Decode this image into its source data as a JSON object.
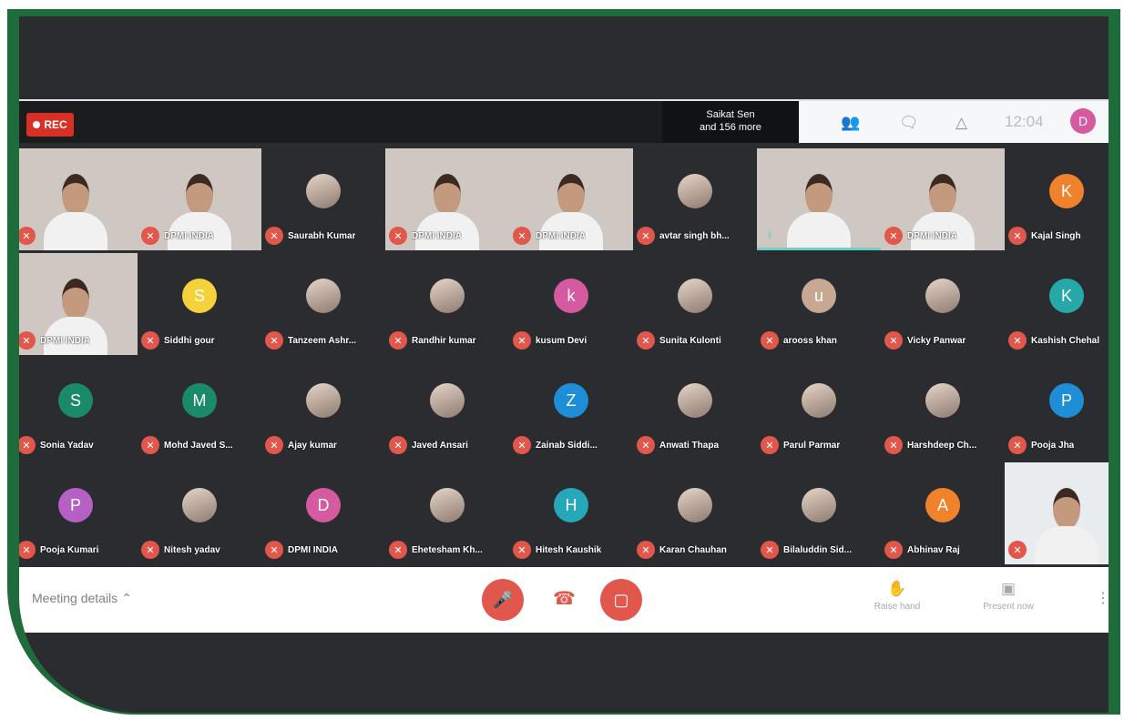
{
  "recording_label": "REC",
  "presenter": {
    "line1": "Saikat Sen",
    "line2": "and 156 more"
  },
  "topbar": {
    "participants_icon": "people-icon",
    "chat_icon": "chat-icon",
    "activities_icon": "shapes-icon",
    "time": "12:04",
    "self_initial": "D"
  },
  "colors": {
    "accent_red": "#e2574c",
    "frame_green": "#1e6b3b",
    "grid_bg": "#2a2c30"
  },
  "tiles": [
    {
      "name": "",
      "kind": "video"
    },
    {
      "name": "DPMI INDIA",
      "kind": "video"
    },
    {
      "name": "Saurabh Kumar",
      "kind": "avatar",
      "color": "photo"
    },
    {
      "name": "DPMI INDIA",
      "kind": "video"
    },
    {
      "name": "DPMI INDIA",
      "kind": "video"
    },
    {
      "name": "avtar singh bh...",
      "kind": "avatar",
      "color": "photo"
    },
    {
      "name": "",
      "kind": "video",
      "speaking": true
    },
    {
      "name": "DPMI INDIA",
      "kind": "video"
    },
    {
      "name": "Kajal Singh",
      "kind": "avatar",
      "initial": "K",
      "color": "#f0822c"
    },
    {
      "name": "DPMI INDIA",
      "kind": "video"
    },
    {
      "name": "Siddhi gour",
      "kind": "avatar",
      "initial": "S",
      "color": "#f3d23b"
    },
    {
      "name": "Tanzeem Ashr...",
      "kind": "avatar",
      "color": "photo"
    },
    {
      "name": "Randhir kumar",
      "kind": "avatar",
      "color": "photo"
    },
    {
      "name": "kusum Devi",
      "kind": "avatar",
      "initial": "k",
      "color": "#d65aa0"
    },
    {
      "name": "Sunita Kulonti",
      "kind": "avatar",
      "color": "photo"
    },
    {
      "name": "arooss khan",
      "kind": "avatar",
      "initial": "u",
      "color": "#c8a793"
    },
    {
      "name": "Vicky Panwar",
      "kind": "avatar",
      "color": "photo"
    },
    {
      "name": "Kashish Chehal",
      "kind": "avatar",
      "initial": "K",
      "color": "#26a8a8"
    },
    {
      "name": "Sonia Yadav",
      "kind": "avatar",
      "initial": "S",
      "color": "#1b8a6b"
    },
    {
      "name": "Mohd Javed S...",
      "kind": "avatar",
      "initial": "M",
      "color": "#1b8a6b"
    },
    {
      "name": "Ajay kumar",
      "kind": "avatar",
      "color": "photo"
    },
    {
      "name": "Javed Ansari",
      "kind": "avatar",
      "color": "photo"
    },
    {
      "name": "Zainab Siddi...",
      "kind": "avatar",
      "initial": "Z",
      "color": "#1e8fd6"
    },
    {
      "name": "Anwati Thapa",
      "kind": "avatar",
      "color": "photo"
    },
    {
      "name": "Parul Parmar",
      "kind": "avatar",
      "color": "photo"
    },
    {
      "name": "Harshdeep Ch...",
      "kind": "avatar",
      "color": "photo"
    },
    {
      "name": "Pooja Jha",
      "kind": "avatar",
      "initial": "P",
      "color": "#1e8fd6"
    },
    {
      "name": "Pooja Kumari",
      "kind": "avatar",
      "initial": "P",
      "color": "#b65fc4"
    },
    {
      "name": "Nitesh yadav",
      "kind": "avatar",
      "color": "photo"
    },
    {
      "name": "DPMI INDIA",
      "kind": "avatar",
      "initial": "D",
      "color": "#d65aa0"
    },
    {
      "name": "Ehetesham Kh...",
      "kind": "avatar",
      "color": "photo"
    },
    {
      "name": "Hitesh Kaushik",
      "kind": "avatar",
      "initial": "H",
      "color": "#26a8b8"
    },
    {
      "name": "Karan Chauhan",
      "kind": "avatar",
      "color": "photo"
    },
    {
      "name": "Bilaluddin Sid...",
      "kind": "avatar",
      "color": "photo"
    },
    {
      "name": "Abhinav Raj",
      "kind": "avatar",
      "initial": "A",
      "color": "#f0822c"
    },
    {
      "name": "",
      "kind": "self"
    }
  ],
  "bottom": {
    "meeting_details": "Meeting details",
    "raise_hand": "Raise hand",
    "present_now": "Present now"
  }
}
